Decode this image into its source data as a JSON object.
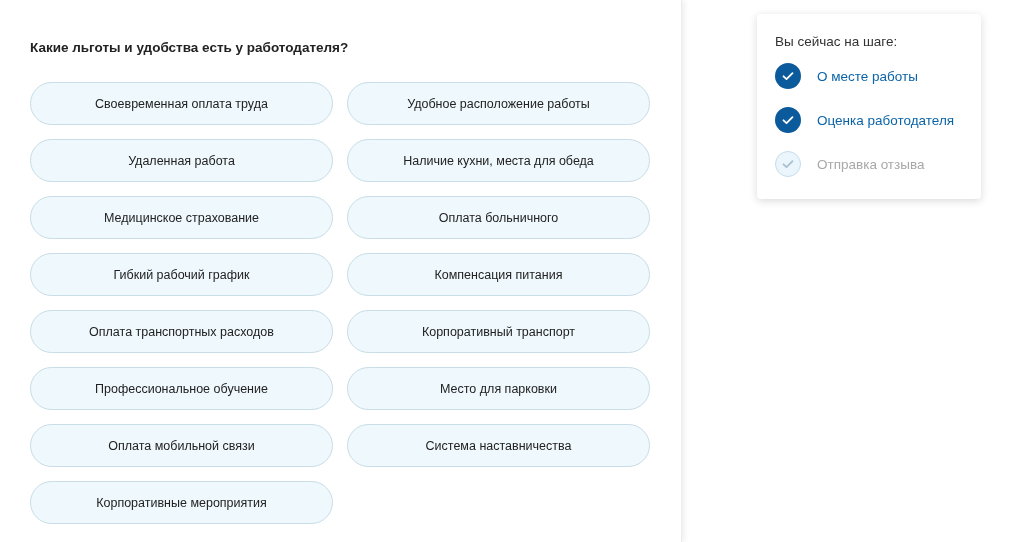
{
  "question": "Какие льготы и удобства есть у работодателя?",
  "options": [
    {
      "label": "Своевременная оплата труда",
      "selected": false
    },
    {
      "label": "Удобное расположение работы",
      "selected": false
    },
    {
      "label": "Удаленная работа",
      "selected": false
    },
    {
      "label": "Наличие кухни, места для обеда",
      "selected": false
    },
    {
      "label": "Медицинское страхование",
      "selected": false
    },
    {
      "label": "Оплата больничного",
      "selected": false
    },
    {
      "label": "Гибкий рабочий график",
      "selected": false
    },
    {
      "label": "Компенсация питания",
      "selected": false
    },
    {
      "label": "Оплата транспортных расходов",
      "selected": false
    },
    {
      "label": "Корпоративный транспорт",
      "selected": false
    },
    {
      "label": "Профессиональное обучение",
      "selected": false
    },
    {
      "label": "Место для парковки",
      "selected": false
    },
    {
      "label": "Оплата мобильной связи",
      "selected": false
    },
    {
      "label": "Система наставничества",
      "selected": false
    },
    {
      "label": "Корпоративные мероприятия",
      "selected": false
    }
  ],
  "steps_panel": {
    "title": "Вы сейчас на шаге:",
    "steps": [
      {
        "label": "О месте работы",
        "done": true
      },
      {
        "label": "Оценка работодателя",
        "done": true
      },
      {
        "label": "Отправка отзыва",
        "done": false
      }
    ]
  }
}
